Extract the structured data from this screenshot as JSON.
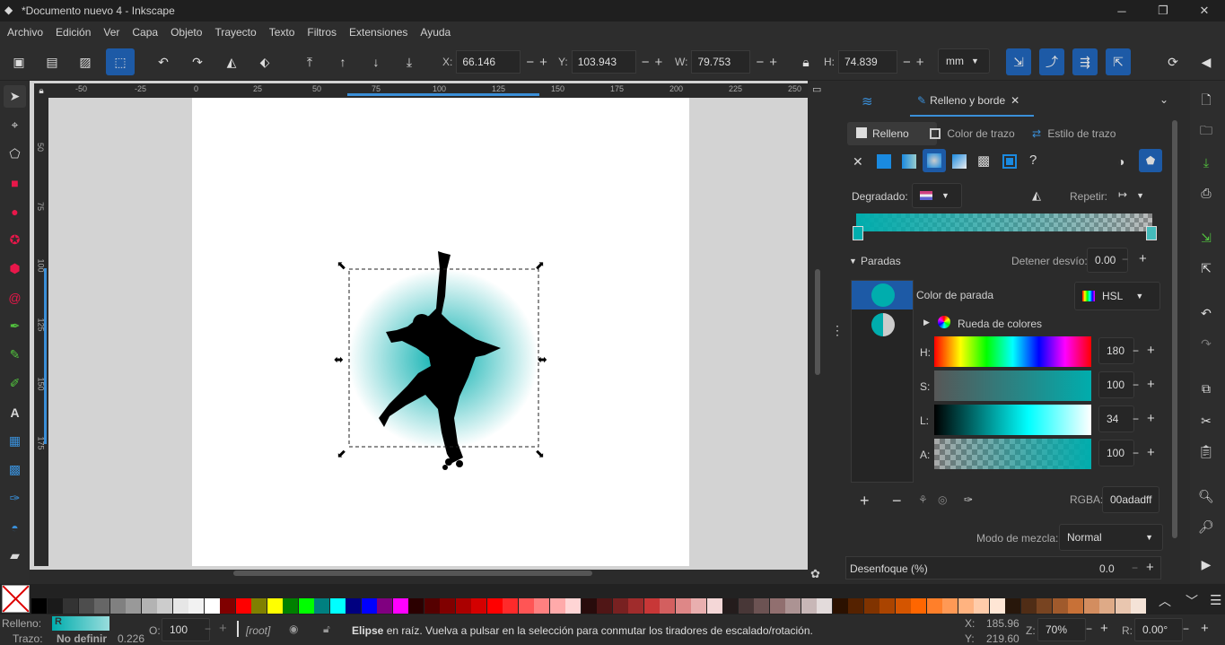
{
  "window": {
    "title": "*Documento nuevo 4 - Inkscape",
    "minimize_icon": "minimize-icon",
    "maximize_icon": "maximize-icon",
    "close_icon": "close-icon"
  },
  "menu": [
    "Archivo",
    "Edición",
    "Ver",
    "Capa",
    "Objeto",
    "Trayecto",
    "Texto",
    "Filtros",
    "Extensiones",
    "Ayuda"
  ],
  "controls": {
    "x_label": "X:",
    "x_value": "66.146",
    "y_label": "Y:",
    "y_value": "103.943",
    "w_label": "W:",
    "w_value": "79.753",
    "h_label": "H:",
    "h_value": "74.839",
    "unit": "mm"
  },
  "ruler": {
    "h_ticks": [
      "-50",
      "-25",
      "0",
      "25",
      "50",
      "75",
      "100",
      "125",
      "150",
      "175",
      "200",
      "225",
      "250"
    ],
    "v_ticks": [
      "50",
      "75",
      "100",
      "125",
      "150",
      "175"
    ]
  },
  "panel": {
    "tab_active": "Relleno y borde",
    "subtabs": [
      "Relleno",
      "Color de trazo",
      "Estilo de trazo"
    ],
    "gradient_label": "Degradado:",
    "repeat_label": "Repetir:",
    "stops_label": "Paradas",
    "offset_label": "Detener desvío:",
    "offset_value": "0.00",
    "stop_color_label": "Color de parada",
    "color_mode": "HSL",
    "wheel_label": "Rueda de colores",
    "h_label": "H:",
    "h_value": "180",
    "s_label": "S:",
    "s_value": "100",
    "l_label": "L:",
    "l_value": "34",
    "a_label": "A:",
    "a_value": "100",
    "rgba_label": "RGBA:",
    "rgba_value": "00adadff",
    "blend_label": "Modo de mezcla:",
    "blend_value": "Normal",
    "blur_label": "Desenfoque (%)",
    "blur_value": "0.0"
  },
  "status": {
    "fill_label": "Relleno:",
    "fill_value": "R",
    "stroke_label": "Trazo:",
    "stroke_value": "No definir",
    "stroke_width": "0.226",
    "opacity_label": "O:",
    "opacity_value": "100",
    "layer": "[root]",
    "message_bold": "Elipse",
    "message": " en raíz. Vuelva a pulsar en la selección para conmutar los tiradores de escalado/rotación.",
    "cursor_x_label": "X:",
    "cursor_x": "185.96",
    "cursor_y_label": "Y:",
    "cursor_y": "219.60",
    "zoom_label": "Z:",
    "zoom": "70%",
    "rotate_label": "R:",
    "rotate": "0.00°"
  },
  "colors": {
    "accent": "#1d5aa6",
    "teal": "#00adad",
    "bg": "#2b2b2b"
  },
  "palette_colors": [
    "#000000",
    "#1a1a1a",
    "#333333",
    "#4d4d4d",
    "#666666",
    "#808080",
    "#999999",
    "#b3b3b3",
    "#cccccc",
    "#e6e6e6",
    "#f2f2f2",
    "#ffffff",
    "#800000",
    "#ff0000",
    "#808000",
    "#ffff00",
    "#008000",
    "#00ff00",
    "#008080",
    "#00ffff",
    "#000080",
    "#0000ff",
    "#800080",
    "#ff00ff",
    "#2b0000",
    "#550000",
    "#800000",
    "#aa0000",
    "#d40000",
    "#ff0000",
    "#ff2a2a",
    "#ff5555",
    "#ff8080",
    "#ffaaaa",
    "#ffd5d5",
    "#280b0b",
    "#501616",
    "#782121",
    "#a02c2c",
    "#c83737",
    "#d35f5f",
    "#de8787",
    "#e9afaf",
    "#f4d7d7",
    "#241c1c",
    "#483737",
    "#6c5353",
    "#916f6f",
    "#ac9393",
    "#c8b7b7",
    "#e3dbdb",
    "#2b1100",
    "#552200",
    "#803300",
    "#aa4400",
    "#d45500",
    "#ff6600",
    "#ff7f2a",
    "#ff9955",
    "#ffb380",
    "#ffccaa",
    "#ffe6d5",
    "#28170b",
    "#502d16",
    "#784421",
    "#a05a2c",
    "#c87137",
    "#d38d5f",
    "#deaa87",
    "#e9c6af",
    "#f4e3d7"
  ]
}
